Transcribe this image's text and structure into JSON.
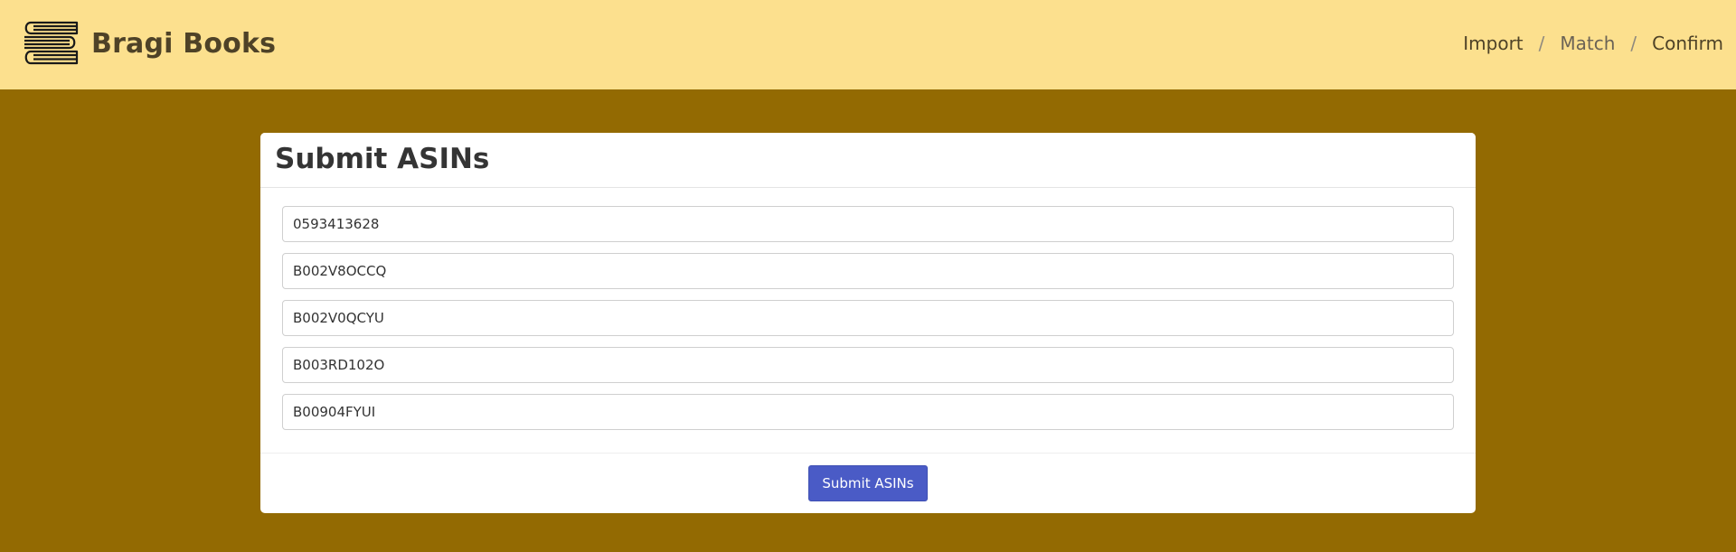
{
  "brand": {
    "name": "Bragi Books",
    "logo_icon": "book-stack-icon"
  },
  "breadcrumb": {
    "items": [
      {
        "label": "Import"
      },
      {
        "label": "Match",
        "active": true
      },
      {
        "label": "Confirm"
      }
    ],
    "separator": "/"
  },
  "card": {
    "title": "Submit ASINs",
    "inputs": [
      {
        "value": "0593413628"
      },
      {
        "value": "B002V8OCCQ"
      },
      {
        "value": "B002V0QCYU"
      },
      {
        "value": "B003RD102O"
      },
      {
        "value": "B00904FYUI"
      }
    ],
    "submit_label": "Submit ASINs"
  },
  "colors": {
    "navbar_bg": "#fce08e",
    "page_bg": "#936a02",
    "brand_text": "#4e4227",
    "button_bg": "#4a5bc6"
  }
}
